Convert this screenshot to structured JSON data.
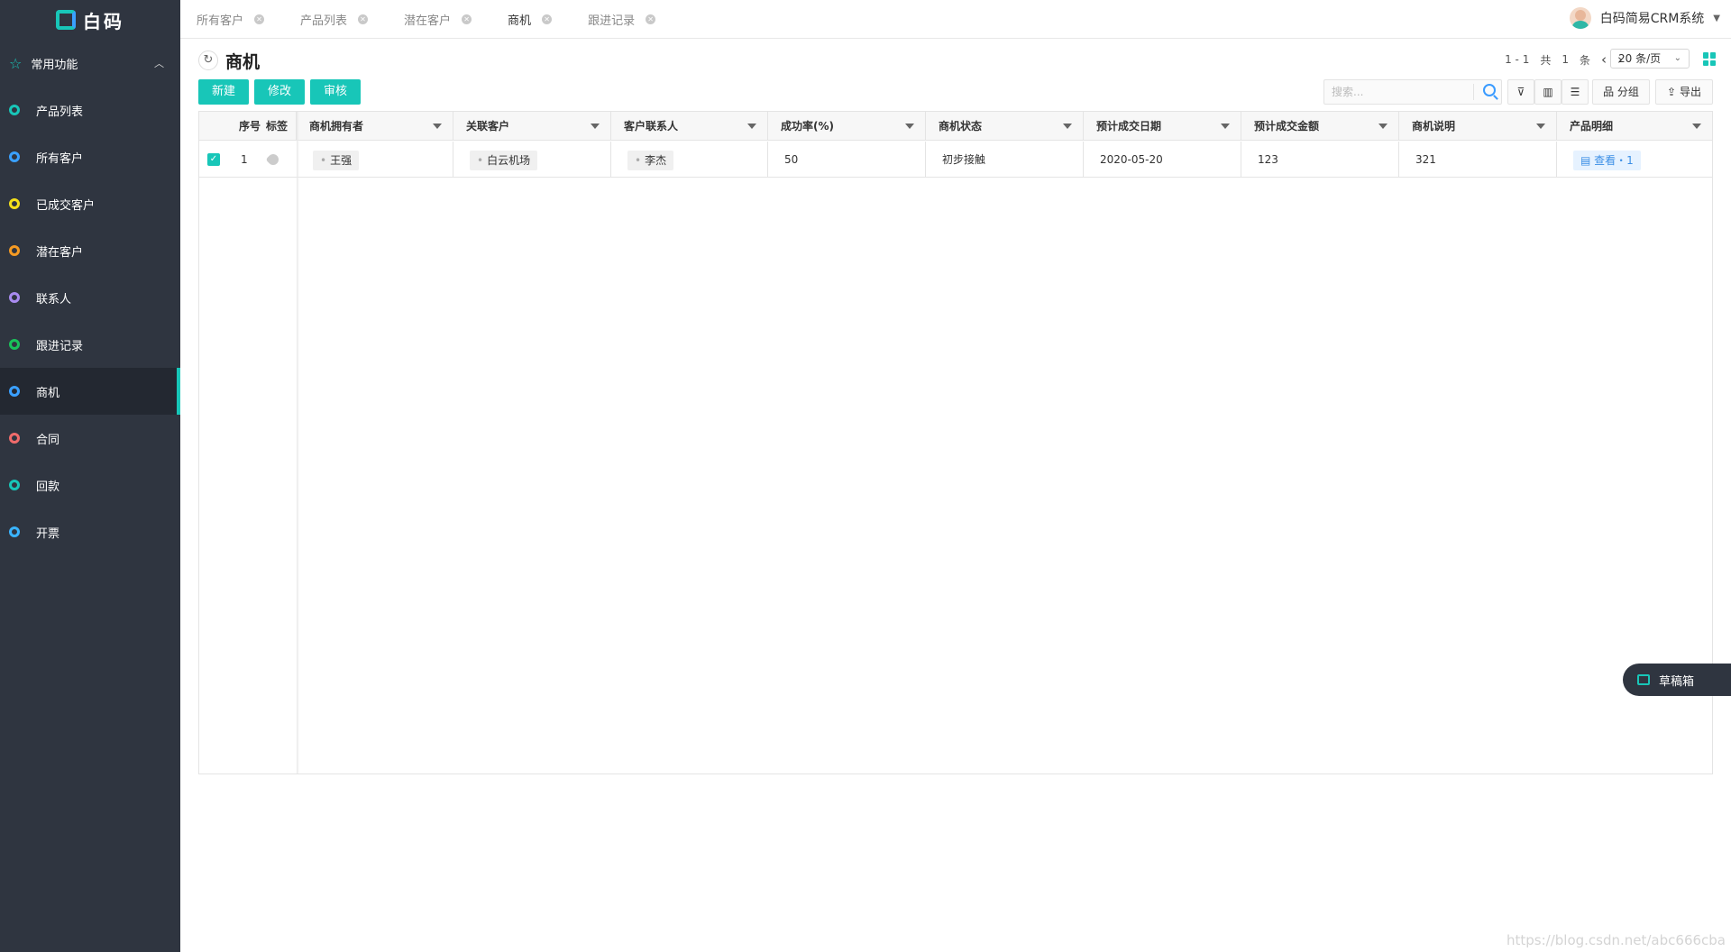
{
  "brand": {
    "name": "白码"
  },
  "sidebar": {
    "group_label": "常用功能",
    "items": [
      {
        "label": "产品列表",
        "color": "#18c6b8"
      },
      {
        "label": "所有客户",
        "color": "#3aa0ff"
      },
      {
        "label": "已成交客户",
        "color": "#f5e11a"
      },
      {
        "label": "潜在客户",
        "color": "#f59a23"
      },
      {
        "label": "联系人",
        "color": "#a98bf0"
      },
      {
        "label": "跟进记录",
        "color": "#19c25a"
      },
      {
        "label": "商机",
        "color": "#3aa0ff",
        "active": true
      },
      {
        "label": "合同",
        "color": "#f06b6b"
      },
      {
        "label": "回款",
        "color": "#18c6b8"
      },
      {
        "label": "开票",
        "color": "#3ab4ff"
      }
    ]
  },
  "tabs": [
    {
      "label": "所有客户"
    },
    {
      "label": "产品列表"
    },
    {
      "label": "潜在客户"
    },
    {
      "label": "商机"
    },
    {
      "label": "跟进记录"
    }
  ],
  "user": {
    "name": "白码简易CRM系统"
  },
  "page": {
    "title": "商机"
  },
  "pager": {
    "range": "1 - 1",
    "total_prefix": "共",
    "total": "1",
    "total_suffix": "条",
    "page_size": "20 条/页"
  },
  "toolbar": {
    "new_label": "新建",
    "edit_label": "修改",
    "review_label": "审核",
    "search_placeholder": "搜索...",
    "group_label": "分组",
    "export_label": "导出"
  },
  "table": {
    "index_header": "序号",
    "tag_header": "标签",
    "columns": [
      "商机拥有者",
      "关联客户",
      "客户联系人",
      "成功率(%)",
      "商机状态",
      "预计成交日期",
      "预计成交金额",
      "商机说明",
      "产品明细"
    ],
    "rows": [
      {
        "index": "1",
        "owner": "王强",
        "customer": "白云机场",
        "contact": "李杰",
        "success_rate": "50",
        "status": "初步接触",
        "expected_date": "2020-05-20",
        "expected_amount": "123",
        "description": "321",
        "detail_link": "查看・1"
      }
    ]
  },
  "draft": {
    "label": "草稿箱"
  },
  "watermark": "https://blog.csdn.net/abc666cba",
  "colors": {
    "accent": "#18c6b8",
    "sidebar_bg": "#2f3540"
  }
}
